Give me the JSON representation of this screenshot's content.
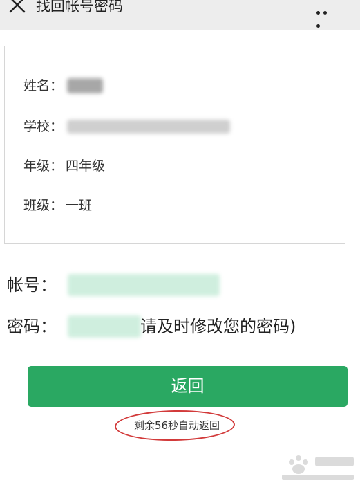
{
  "header": {
    "title": "找回帐号密码"
  },
  "info": {
    "name_label": "姓名：",
    "school_label": "学校：",
    "grade_label": "年级：",
    "grade_value": "四年级",
    "class_label": "班级：",
    "class_value": "一班"
  },
  "credentials": {
    "account_label": "帐号：",
    "password_label": "密码：",
    "password_note": "请及时修改您的密码)"
  },
  "actions": {
    "back_label": "返回"
  },
  "countdown": {
    "text": "剩余56秒自动返回"
  },
  "colors": {
    "topbar_bg": "#ededed",
    "button_green": "#2aa862",
    "highlight_red": "#d23a3a",
    "blur_green": "#d3f0e1"
  },
  "icons": {
    "close": "close-icon",
    "more": "more-icon"
  }
}
